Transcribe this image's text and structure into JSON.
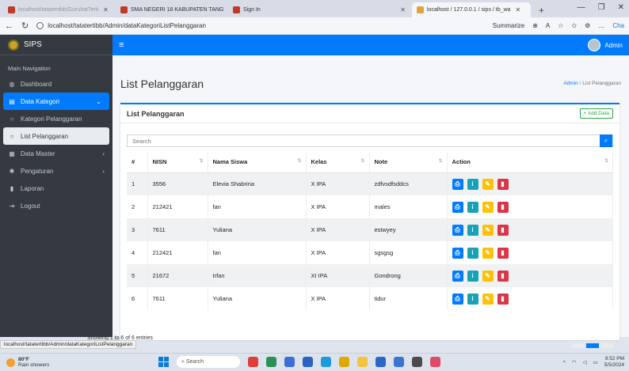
{
  "browser": {
    "tabs": [
      {
        "label": "localhost/tatatertibb/Guru/tatTerti",
        "color": "#c0392b"
      },
      {
        "label": "SMA NEGERI 18 KABUPATEN TANG",
        "color": "#c0392b"
      },
      {
        "label": "Sign In",
        "color": "#c0392b"
      },
      {
        "label": "localhost / 127.0.0.1 / sips / tb_wa",
        "color": "#e6a23c"
      }
    ],
    "new_tab": "+",
    "url": "localhost/tatatertibb/Admin/dataKategoriListPelanggaran",
    "summarize": "Summarize",
    "chat": "Cha"
  },
  "app": {
    "brand": "SIPS",
    "user": "Admin"
  },
  "sidebar": {
    "heading": "Main Navigation",
    "items": [
      {
        "label": "Dashboard",
        "icon": "palette-icon"
      },
      {
        "label": "Data Kategori",
        "icon": "folder-icon"
      },
      {
        "label": "Kategori Pelanggaran",
        "icon": "circle-icon"
      },
      {
        "label": "List Pelanggaran",
        "icon": "circle-icon"
      },
      {
        "label": "Data Master",
        "icon": "table-icon"
      },
      {
        "label": "Pengaturan",
        "icon": "gear-icon"
      },
      {
        "label": "Laporan",
        "icon": "file-icon"
      },
      {
        "label": "Logout",
        "icon": "logout-icon"
      }
    ]
  },
  "page": {
    "title": "List Pelanggaran",
    "breadcrumb": {
      "home": "Admin",
      "sep": "/",
      "current": "List Pelanggaran"
    },
    "card_title": "List Pelanggaran",
    "add_button": "+ Add Data",
    "search_placeholder": "Search",
    "showing": "Showing 1 to 6 of 6 entries"
  },
  "table": {
    "headers": [
      "#",
      "NISN",
      "Nama Siswa",
      "Kelas",
      "Note",
      "Action"
    ],
    "rows": [
      {
        "no": "1",
        "nisn": "3556",
        "nama": "Elevia Shabrina",
        "kelas": "X IPA",
        "note": "zdfvsdfsddcs"
      },
      {
        "no": "2",
        "nisn": "212421",
        "nama": "fan",
        "kelas": "X IPA",
        "note": "males"
      },
      {
        "no": "3",
        "nisn": "7611",
        "nama": "Yuliana",
        "kelas": "X IPA",
        "note": "estwyey"
      },
      {
        "no": "4",
        "nisn": "212421",
        "nama": "fan",
        "kelas": "X IPA",
        "note": "sgsgsg"
      },
      {
        "no": "5",
        "nisn": "21672",
        "nama": "Irfan",
        "kelas": "XI IPA",
        "note": "Gondrong"
      },
      {
        "no": "6",
        "nisn": "7611",
        "nama": "Yuliana",
        "kelas": "X IPA",
        "note": "tidur"
      }
    ]
  },
  "status_url": "localhost/tatatertibb/Admin/dataKategoriListPelanggaran",
  "taskbar": {
    "temp": "80°F",
    "weather": "Rain showers",
    "search": "Search",
    "time": "9:52 PM",
    "date": "5/5/2024"
  }
}
